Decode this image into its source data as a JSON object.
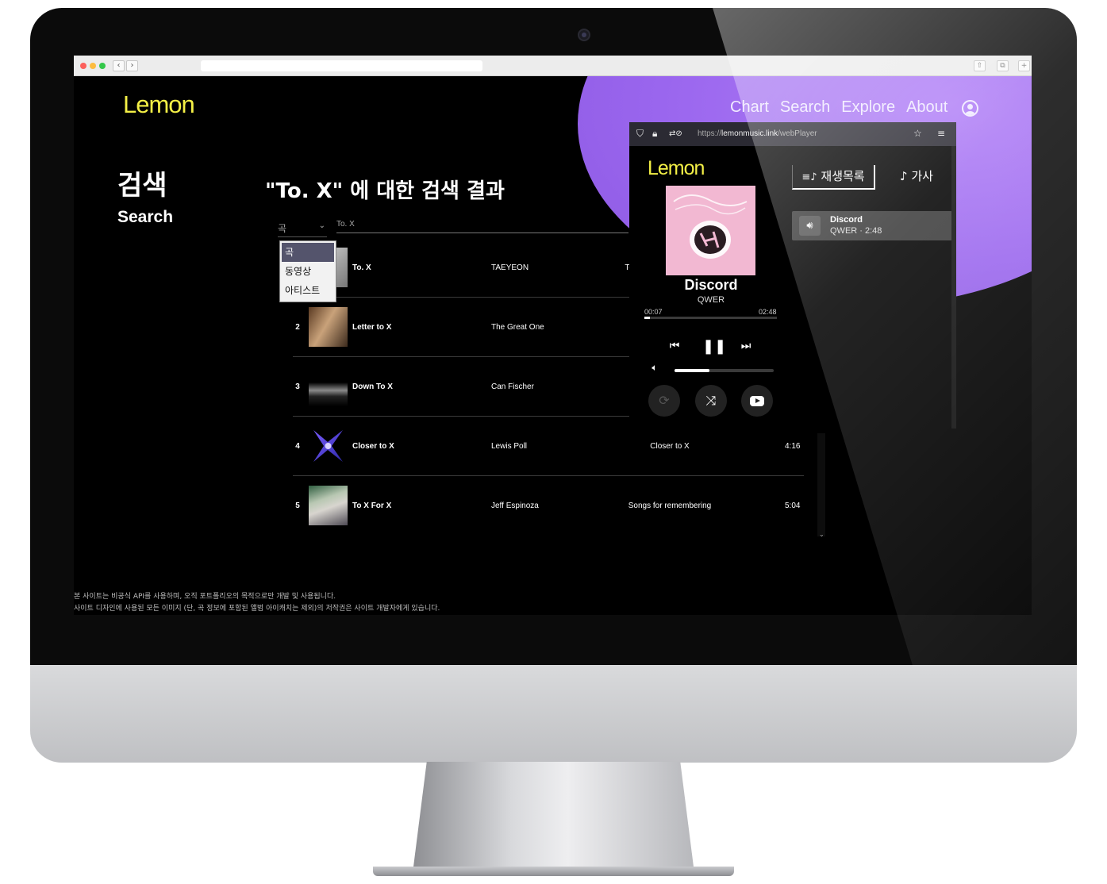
{
  "brand": {
    "logo_text": "Lemon",
    "accent": "#f4f046",
    "blob_color": "#9a66ee"
  },
  "nav": {
    "items": [
      "Chart",
      "Search",
      "Explore",
      "About"
    ],
    "profile_icon": "user-circle-icon"
  },
  "search_page": {
    "title_ko": "검색",
    "title_en": "Search",
    "result_heading": "\"To. X\" 에 대한 검색 결과",
    "filter_value": "곡",
    "query": "To. X",
    "filter_options": [
      "곡",
      "동영상",
      "아티스트"
    ]
  },
  "results": [
    {
      "num": "1",
      "title": "To. X",
      "artist": "TAEYEON",
      "album": "To. X - T",
      "duration": ""
    },
    {
      "num": "2",
      "title": "Letter to X",
      "artist": "The Great One",
      "album": "",
      "duration": ""
    },
    {
      "num": "3",
      "title": "Down To X",
      "artist": "Can Fischer",
      "album": "",
      "duration": ""
    },
    {
      "num": "4",
      "title": "Closer to X",
      "artist": "Lewis Poll",
      "album": "Closer to X",
      "duration": "4:16"
    },
    {
      "num": "5",
      "title": "To X For X",
      "artist": "Jeff Espinoza",
      "album": "Songs for remembering",
      "duration": "5:04"
    }
  ],
  "footer": {
    "line1": "본 사이트는 비공식 API를 사용하며, 오직 포트폴리오의 목적으로만 개발 및 사용됩니다.",
    "line2": "사이트 디자인에 사용된 모든 이미지 (단, 곡 정보에 포함된 앨범 아이캐치는 제외)의 저작권은 사이트 개발자에게 있습니다."
  },
  "player": {
    "url_prefix": "https://",
    "url_domain": "lemonmusic.link",
    "url_path": "/webPlayer",
    "logo_text": "Lemon",
    "track_title": "Discord",
    "track_artist": "QWER",
    "elapsed": "00:07",
    "total": "02:48",
    "progress": 0.04,
    "volume": 0.35,
    "tab_queue": "재생목록",
    "tab_lyrics": "가사",
    "queue": [
      {
        "title": "Discord",
        "subtitle": "QWER · 2:48"
      }
    ]
  }
}
